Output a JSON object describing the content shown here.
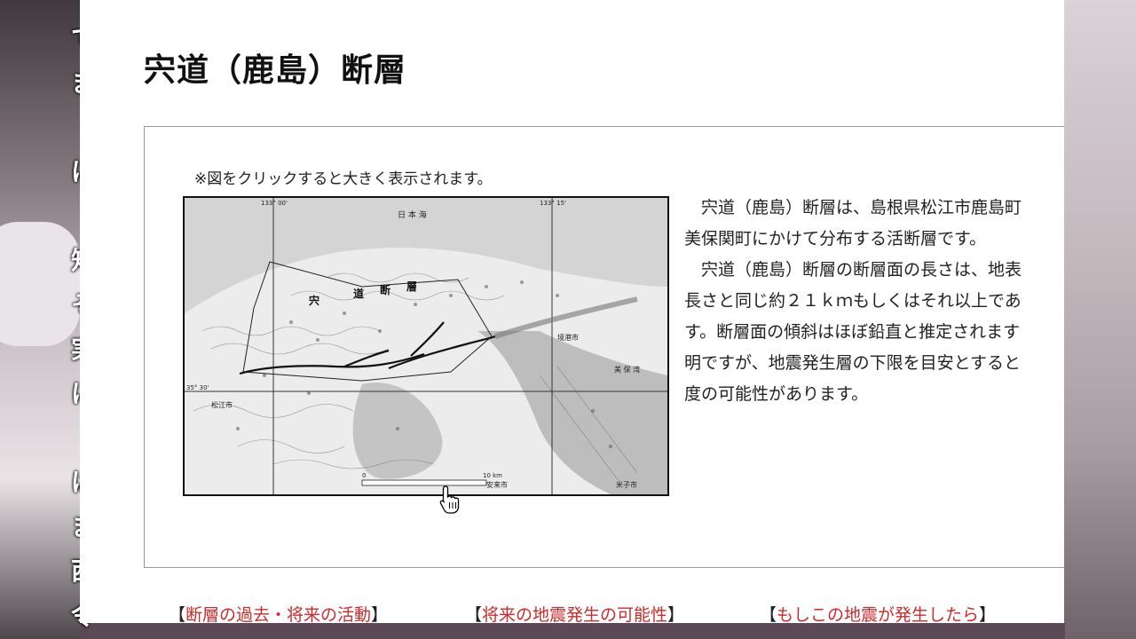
{
  "page": {
    "title": "宍道（鹿島）断層",
    "note": "※図をクリックすると大きく表示されます。",
    "description_lines": [
      "　宍道（鹿島）断層は、島根県松江市鹿島町",
      "美保関町にかけて分布する活断層です。",
      "　宍道（鹿島）断層の断層面の長さは、地表",
      "長さと同じ約２１ｋｍもしくはそれ以上であ",
      "す。断層面の傾斜はほぼ鉛直と推定されます",
      "明ですが、地震発生層の下限を目安とすると",
      "度の可能性があります。"
    ]
  },
  "map": {
    "top_labels": [
      "133° 00'",
      "133° 15'"
    ],
    "left_label": "35° 30'",
    "sea_label": "日 本 海",
    "fault_label": [
      "宍",
      "道",
      "断",
      "層"
    ],
    "place_labels": [
      "境港市",
      "松江市",
      "安来市",
      "米子市",
      "美 保 湾"
    ],
    "scale": [
      "0",
      "10 km"
    ]
  },
  "links": [
    {
      "label": "断層の過去・将来の活動"
    },
    {
      "label": "将来の地震発生の可能性"
    },
    {
      "label": "もしこの地震が発生したら"
    }
  ],
  "bracket_open": "【",
  "bracket_close": "】",
  "overlay_chars": [
    "で",
    "ま",
    "に",
    "知",
    "そ",
    "実",
    "に",
    "は",
    "ま",
    "西",
    "令"
  ],
  "colors": {
    "link_red": "#cc2b2b",
    "page_bg": "#ffffff",
    "fault_line": "#111111"
  }
}
